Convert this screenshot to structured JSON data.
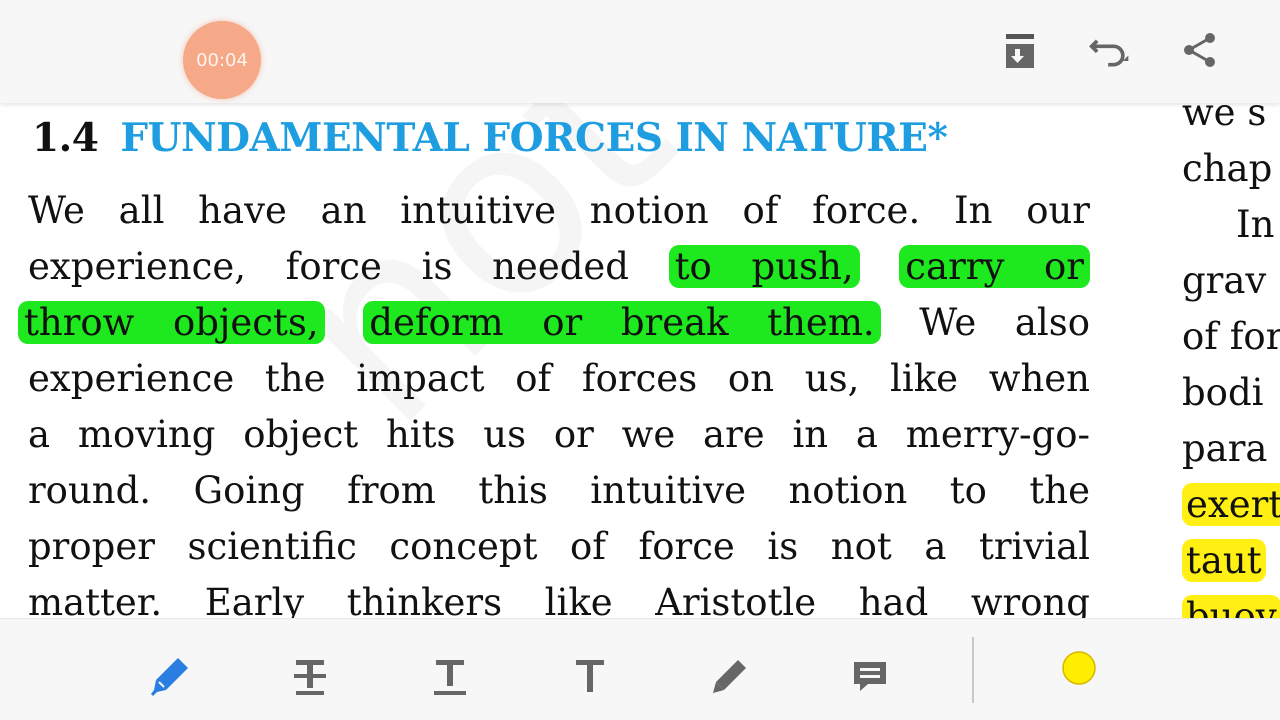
{
  "topbar": {
    "timer": "00:04",
    "icons": [
      "document-reader-icon",
      "undo-icon",
      "share-icon"
    ]
  },
  "document": {
    "watermark": "not to",
    "heading": {
      "number": "1.4",
      "title": "FUNDAMENTAL FORCES IN NATURE*"
    },
    "lines": [
      {
        "t1": "We all have an intuitive notion of force. In our"
      },
      {
        "t1": "experience, force is needed ",
        "h1": "to push,",
        "t2": " ",
        "h2": "carry or"
      },
      {
        "h1": "throw objects,",
        "t2": " ",
        "h2": "deform or break them.",
        "t3": "  We also"
      },
      {
        "t1": "experience the impact of forces on us, like when"
      },
      {
        "t1": "a moving object hits us or we are in a merry-go-"
      },
      {
        "t1": "round. Going from this intuitive notion to the"
      },
      {
        "t1": "proper scientific concept of force is not a trivial"
      },
      {
        "t1": "matter. Early thinkers like Aristotle had wrong"
      }
    ],
    "right_column": [
      "we s",
      "chap",
      " In",
      "grav",
      "of for",
      "bodi",
      "para",
      "exert",
      "taut",
      "buoy"
    ],
    "highlight_green": "#1ee81e",
    "highlight_yellow": "#ffef12",
    "heading_color": "#1e9ee0"
  },
  "toolbar": {
    "tools": [
      "highlight-pen-tool",
      "strikethrough-tool",
      "underline-tool",
      "text-tool",
      "pencil-tool",
      "comment-tool"
    ],
    "active_tool": "highlight-pen-tool",
    "active_color": "#ffee00",
    "accent_color": "#2a7de1"
  }
}
